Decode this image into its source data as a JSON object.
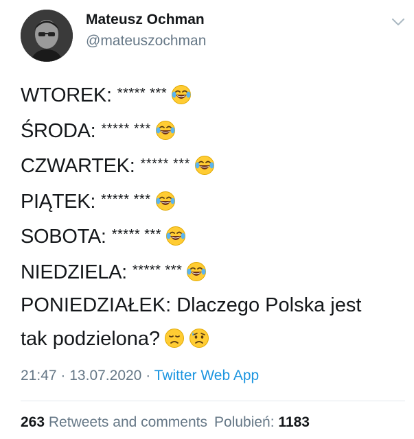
{
  "author": {
    "name": "Mateusz Ochman",
    "handle": "@mateuszochman"
  },
  "icons": {
    "menu": "chevron-down-icon",
    "laughing": "face-with-tears-of-joy-emoji",
    "disappointed": "disappointed-face-emoji",
    "sad": "sad-but-relieved-face-emoji"
  },
  "tweet": {
    "lines": [
      {
        "day": "WTOREK:",
        "stars": "***** ***"
      },
      {
        "day": "ŚRODA:",
        "stars": "***** ***"
      },
      {
        "day": "CZWARTEK:",
        "stars": "***** ***"
      },
      {
        "day": "PIĄTEK:",
        "stars": "***** ***"
      },
      {
        "day": "SOBOTA:",
        "stars": "***** ***"
      },
      {
        "day": "NIEDZIELA:",
        "stars": "***** ***"
      }
    ],
    "final_line_1": "PONIEDZIAŁEK: Dlaczego Polska jest",
    "final_line_2": "tak podzielona?"
  },
  "meta": {
    "time": "21:47",
    "separator": "·",
    "date": "13.07.2020",
    "source": "Twitter Web App"
  },
  "stats": {
    "retweets_count": "263",
    "retweets_label": "Retweets and comments",
    "likes_label": "Polubień:",
    "likes_count": "1183"
  },
  "colors": {
    "text": "#14171a",
    "secondary": "#657786",
    "link": "#1b95e0",
    "divider": "#e1e8ed",
    "emoji_yellow": "#ffcc33"
  }
}
